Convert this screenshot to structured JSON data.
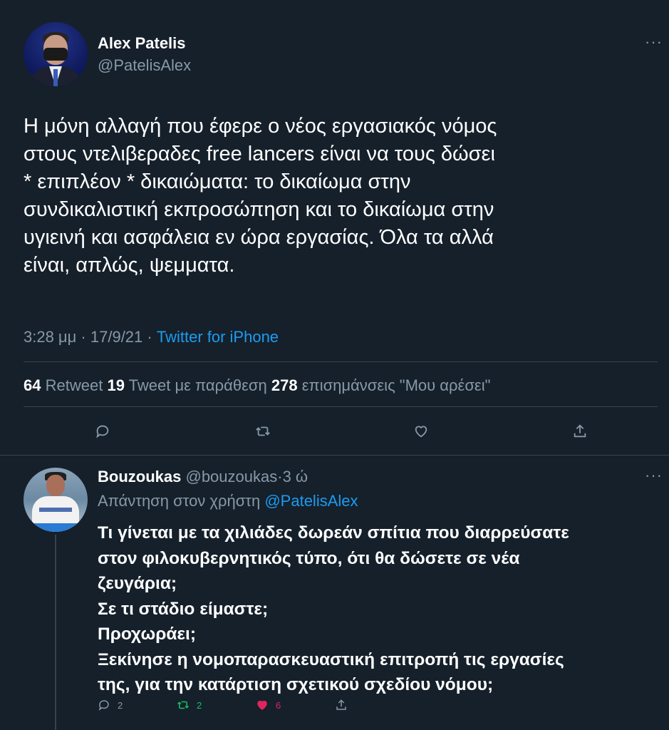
{
  "tweet": {
    "author_name": "Alex Patelis",
    "author_handle": "@PatelisAlex",
    "text": "Η μόνη αλλαγή που έφερε ο νέος εργασιακός νόμος\nστους ντελιβεραδες free lancers είναι να τους δώσει\n* επιπλέον * δικαιώματα: το δικαίωμα στην\nσυνδικαλιστική εκπροσώπηση και το δικαίωμα στην\nυγιεινή και ασφάλεια εν ώρα εργασίας. Όλα τα αλλά\nείναι, απλώς, ψεμματα.",
    "time": "3:28 μμ",
    "date": "17/9/21",
    "source": "Twitter for iPhone",
    "retweets_count": "64",
    "retweets_label": "Retweet",
    "quotes_count": "19",
    "quotes_label": "Tweet με παράθεση",
    "likes_count": "278",
    "likes_label": "επισημάνσεις \"Μου αρέσει\"",
    "more_icon": "more-icon"
  },
  "reply": {
    "author_name": "Bouzoukas",
    "author_handle": "@bouzoukas",
    "time_ago": "3 ώ",
    "replying_to_label": "Απάντηση στον χρήστη",
    "replying_to_handle": "@PatelisAlex",
    "text": "Τι γίνεται με τα χιλιάδες δωρεάν σπίτια που διαρρεύσατε\nστον φιλοκυβερνητικός τύπο, ότι θα δώσετε σε νέα\nζευγάρια;\nΣε τι στάδιο είμαστε;\nΠροχωράει;\nΞεκίνησε η νομοπαρασκευαστική επιτροπή τις εργασίες\nτης, για την κατάρτιση σχετικού σχεδίου νόμου;",
    "reply_count": "2",
    "retweet_count": "2",
    "like_count": "6"
  },
  "colors": {
    "background": "#15202b",
    "accent": "#1d9bf0",
    "muted": "#8899a6",
    "retweet_green": "#17bf63",
    "like_red": "#e0245e"
  }
}
